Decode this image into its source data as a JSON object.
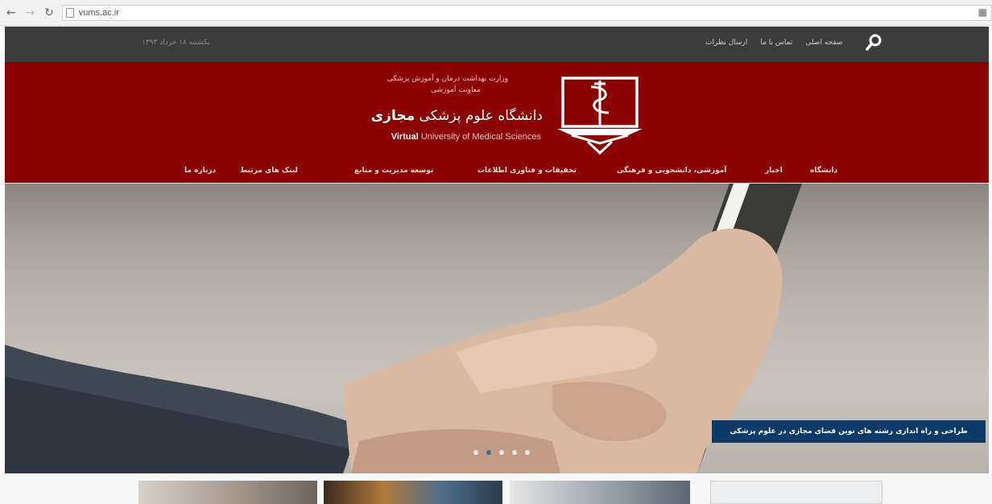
{
  "browser": {
    "url": "vums.ac.ir"
  },
  "topbar": {
    "date": "یکشنبه ۱۸ خرداد ۱۳۹۳",
    "links": [
      "صفحه اصلی",
      "تماس با ما",
      "ارسال نظرات"
    ]
  },
  "header": {
    "supertitle_1": "وزارت بهداشت درمان و آموزش پزشکی",
    "supertitle_2": "معاونت آموزشی",
    "title_fa_regular": "دانشگاه علوم پزشکی ",
    "title_fa_bold": "مجازی",
    "title_en_bold": "Virtual",
    "title_en_regular": " University of Medical Sciences"
  },
  "nav": {
    "items": [
      "دانشگاه",
      "اخبار",
      "آموزشی، دانشجویی و فرهنگی",
      "تحقیقات و فناوری اطلاعات",
      "توسعه مدیریت و منابع",
      "لینک های مرتبط",
      "درباره ما"
    ]
  },
  "hero": {
    "caption": "طراحی و راه اندازی رشته های نوین فضای مجازی در علوم پزشکی",
    "slides_count": 5,
    "active_slide": 2
  },
  "colors": {
    "header_red": "#8b0000",
    "topbar_dark": "#3c3c3c",
    "caption_blue": "#0d3a66"
  }
}
